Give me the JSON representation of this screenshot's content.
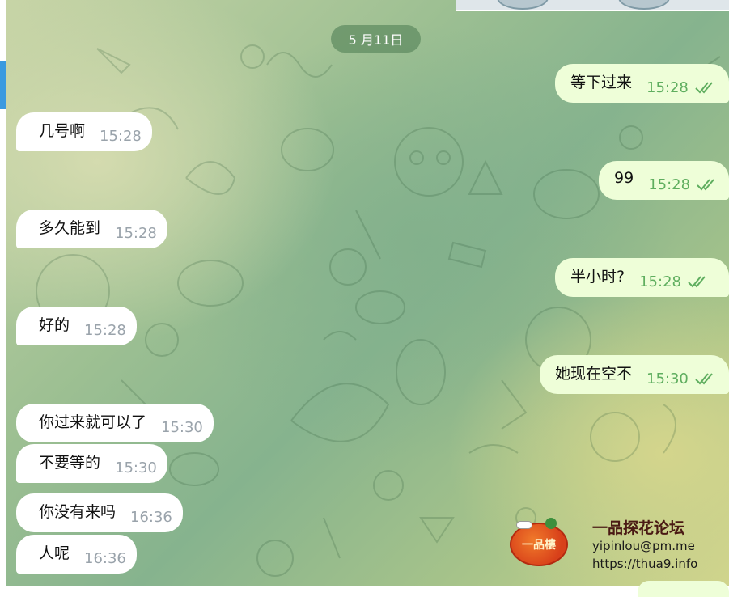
{
  "date_separator": "5 月11日",
  "colors": {
    "incoming_bg": "#ffffff",
    "outgoing_bg": "#eefed8",
    "outgoing_time": "#5fae5f",
    "incoming_time": "#9aa3ab",
    "date_pill": "#6a9a6c"
  },
  "messages": [
    {
      "direction": "out",
      "text": "等下过来",
      "time": "15:28",
      "status_icon": "double-check-icon"
    },
    {
      "direction": "in",
      "text": "几号啊",
      "time": "15:28"
    },
    {
      "direction": "out",
      "text": "99",
      "time": "15:28",
      "status_icon": "double-check-icon"
    },
    {
      "direction": "in",
      "text": "多久能到",
      "time": "15:28"
    },
    {
      "direction": "out",
      "text": "半小时?",
      "time": "15:28",
      "status_icon": "double-check-icon"
    },
    {
      "direction": "in",
      "text": "好的",
      "time": "15:28"
    },
    {
      "direction": "out",
      "text": "她现在空不",
      "time": "15:30",
      "status_icon": "double-check-icon"
    },
    {
      "direction": "in",
      "text": "你过来就可以了",
      "time": "15:30"
    },
    {
      "direction": "in",
      "text": "不要等的",
      "time": "15:30"
    },
    {
      "direction": "in",
      "text": "你没有来吗",
      "time": "16:36"
    },
    {
      "direction": "in",
      "text": "人呢",
      "time": "16:36"
    }
  ],
  "watermark": {
    "logo_text": "一品樓",
    "title": "一品探花论坛",
    "email": "yipinlou@pm.me",
    "url": "https://thua9.info"
  }
}
